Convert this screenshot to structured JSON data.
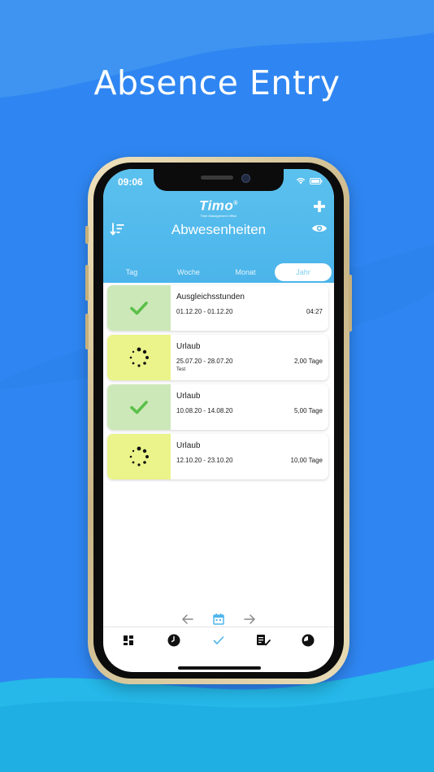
{
  "headline": "Absence Entry",
  "colors": {
    "background": "#2f86f2",
    "header": "#4bb4ea",
    "status_approved": "#cde8b8",
    "status_pending": "#eaf48a",
    "check_green": "#5bc04a",
    "accent": "#4fb5ec"
  },
  "status_bar": {
    "time": "09:06",
    "icons": [
      "wifi-icon",
      "battery-icon"
    ]
  },
  "header": {
    "logo": "Timo",
    "logo_mark": "®",
    "logo_subtitle": "Time Management Office",
    "title": "Abwesenheiten",
    "icons": [
      "plus-icon",
      "sort-icon",
      "eye-icon"
    ]
  },
  "tabs": [
    {
      "label": "Tag",
      "active": false
    },
    {
      "label": "Woche",
      "active": false
    },
    {
      "label": "Monat",
      "active": false
    },
    {
      "label": "Jahr",
      "active": true
    }
  ],
  "entries": [
    {
      "status": "approved",
      "status_icon": "checkmark-icon",
      "title": "Ausgleichsstunden",
      "dates": "01.12.20 - 01.12.20",
      "note": "",
      "duration": "04:27"
    },
    {
      "status": "pending",
      "status_icon": "spinner-icon",
      "title": "Urlaub",
      "dates": "25.07.20 - 28.07.20",
      "note": "Test",
      "duration": "2,00 Tage"
    },
    {
      "status": "approved",
      "status_icon": "checkmark-icon",
      "title": "Urlaub",
      "dates": "10.08.20 - 14.08.20",
      "note": "",
      "duration": "5,00 Tage"
    },
    {
      "status": "pending",
      "status_icon": "spinner-icon",
      "title": "Urlaub",
      "dates": "12.10.20 - 23.10.20",
      "note": "",
      "duration": "10,00 Tage"
    }
  ],
  "pager": {
    "icons": [
      "arrow-left-icon",
      "calendar-icon",
      "arrow-right-icon"
    ]
  },
  "bottom_nav": [
    {
      "icon": "dashboard-icon",
      "active": false
    },
    {
      "icon": "clock-icon",
      "active": false
    },
    {
      "icon": "checkmark-icon",
      "active": true
    },
    {
      "icon": "clipboard-check-icon",
      "active": false
    },
    {
      "icon": "pie-chart-icon",
      "active": false
    }
  ]
}
